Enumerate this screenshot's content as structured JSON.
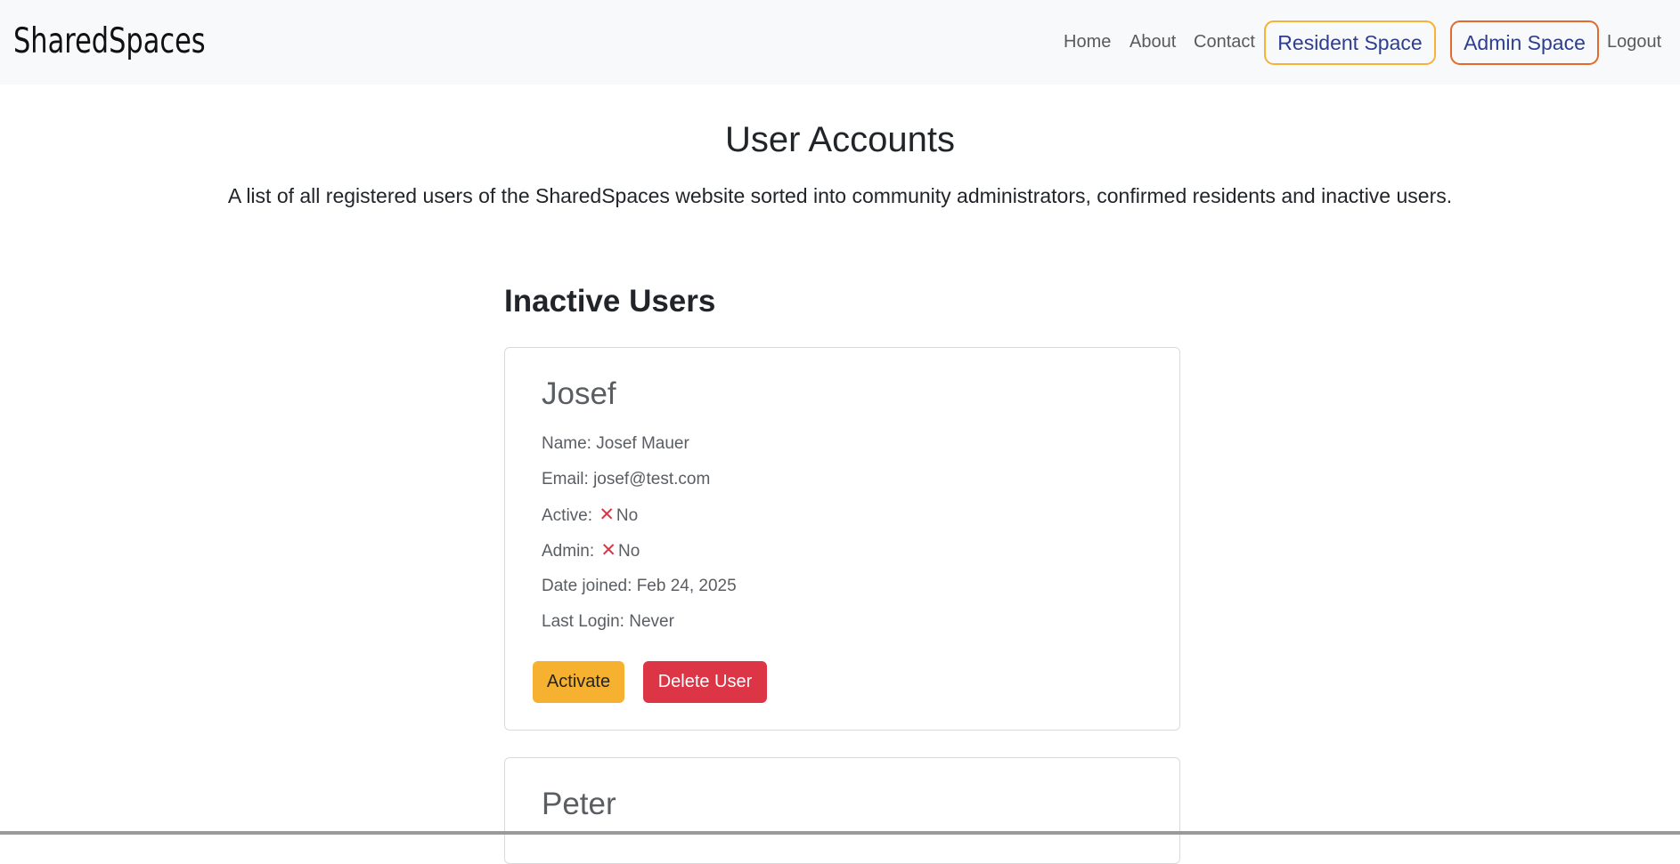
{
  "navbar": {
    "brand": "SharedSpaces",
    "links": {
      "home": "Home",
      "about": "About",
      "contact": "Contact",
      "resident_space": "Resident Space",
      "admin_space": "Admin Space",
      "logout": "Logout"
    },
    "colors": {
      "resident_border": "#f5b233",
      "admin_border": "#e36a2c",
      "pill_text": "#2d3e8f"
    }
  },
  "header": {
    "title": "User Accounts",
    "description": "A list of all registered users of the SharedSpaces website sorted into community administrators, confirmed residents and inactive users."
  },
  "inactive_section": {
    "title": "Inactive Users",
    "users": [
      {
        "heading": "Josef",
        "name_label": "Name:",
        "name_value": "Josef Mauer",
        "email_label": "Email:",
        "email_value": "josef@test.com",
        "active_label": "Active:",
        "active_icon": "x-icon",
        "active_value": "No",
        "admin_label": "Admin:",
        "admin_icon": "x-icon",
        "admin_value": "No",
        "date_label": "Date joined:",
        "date_value": "Feb 24, 2025",
        "login_label": "Last Login:",
        "login_value": "Never",
        "activate_button": "Activate",
        "delete_button": "Delete User"
      },
      {
        "heading": "Peter"
      }
    ]
  },
  "colors": {
    "activate": "#f5b12f",
    "delete": "#dc3545",
    "x_mark": "#dc3545"
  }
}
